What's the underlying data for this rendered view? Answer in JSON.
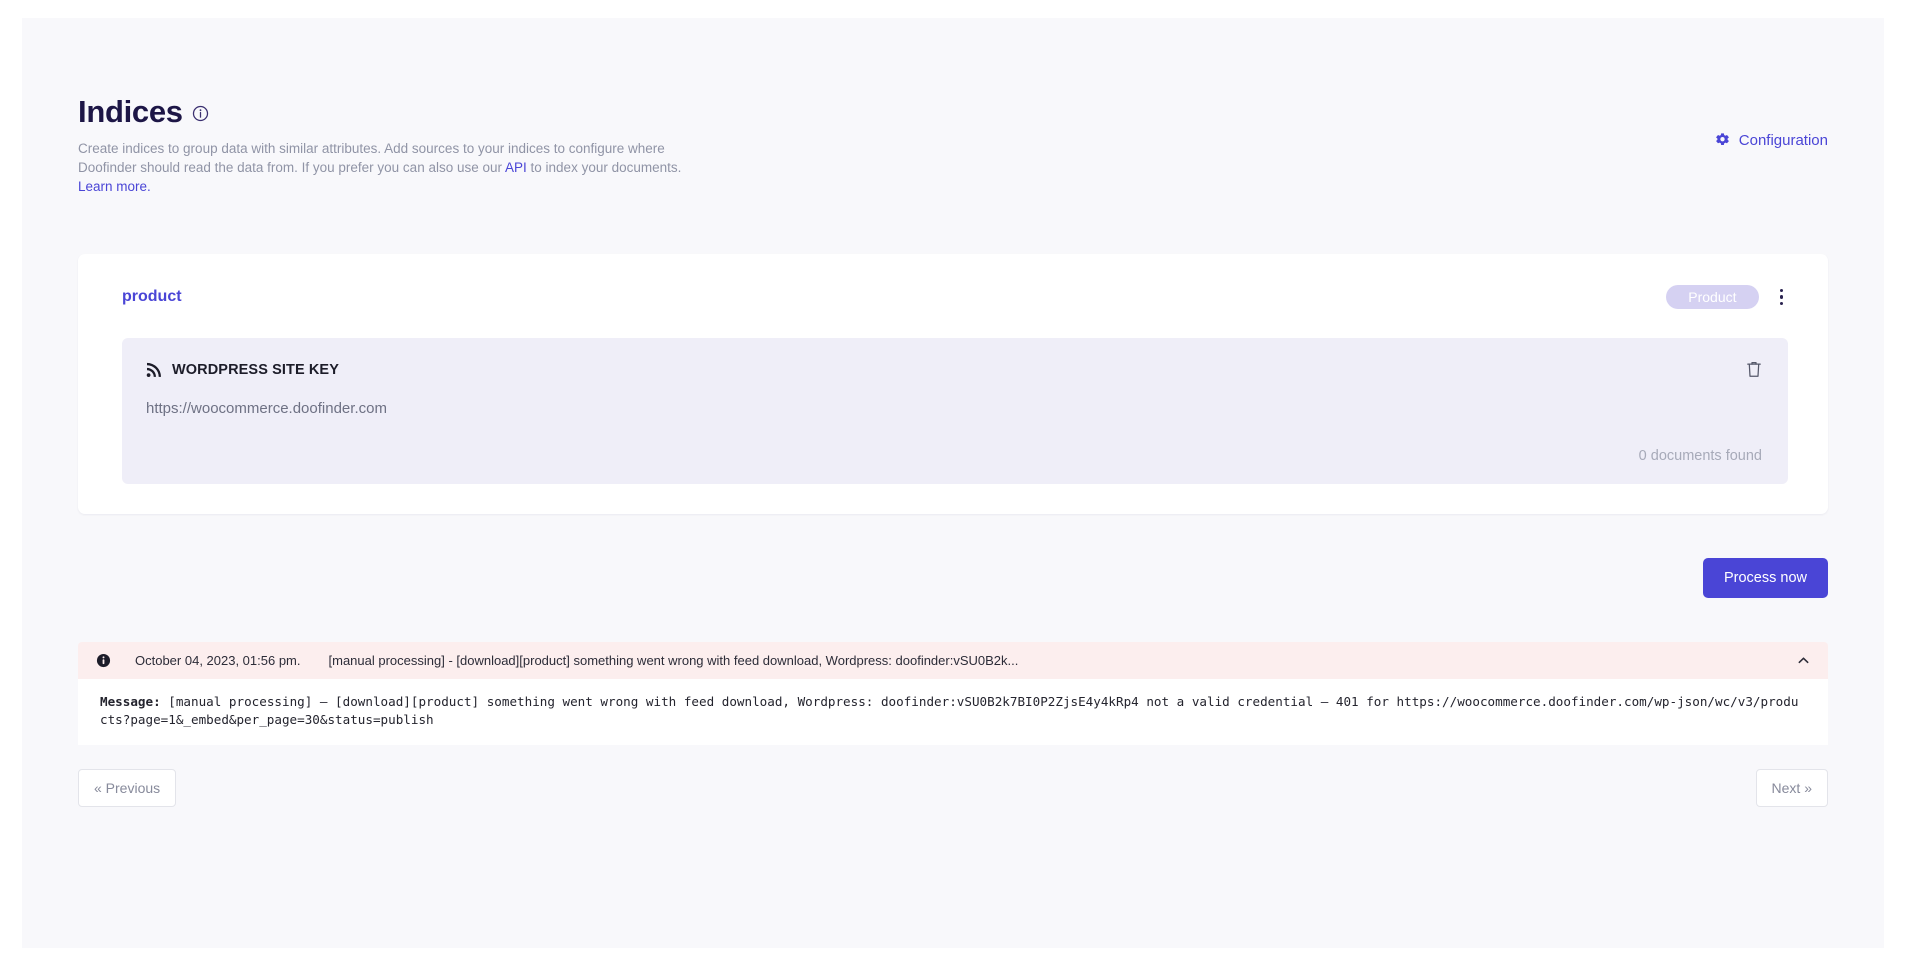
{
  "header": {
    "title": "Indices",
    "info_icon": "info-circle-icon",
    "description_part1": "Create indices to group data with similar attributes. Add sources to your indices to configure where Doofinder should read the data from. If you prefer you can also use our ",
    "description_link": "API",
    "description_part2": " to index your documents.",
    "learn_more": "Learn more.",
    "configuration_label": "Configuration",
    "configuration_icon": "gear-icon"
  },
  "index_card": {
    "name": "product",
    "badge": "Product",
    "kebab_icon": "kebab-menu-icon",
    "source": {
      "icon": "rss-feed-icon",
      "title": "WORDPRESS SITE KEY",
      "url": "https://woocommerce.doofinder.com",
      "delete_icon": "trash-icon",
      "documents_found": "0 documents found"
    }
  },
  "actions": {
    "process_now": "Process now"
  },
  "log": {
    "icon": "info-filled-icon",
    "date": "October 04, 2023, 01:56 pm.",
    "summary": "[manual processing] - [download][product] something went wrong with feed download, Wordpress: doofinder:vSU0B2k...",
    "collapse_icon": "chevron-up-icon",
    "message_label": "Message:",
    "message_body": " [manual processing] – [download][product] something went wrong with feed download, Wordpress: doofinder:vSU0B2k7BI0P2ZjsE4y4kRp4 not a valid credential – 401 for https://woocommerce.doofinder.com/wp-json/wc/v3/products?page=1&_embed&per_page=30&status=publish"
  },
  "pagination": {
    "previous": "« Previous",
    "next": "Next »"
  },
  "colors": {
    "accent": "#4a45d6",
    "title": "#1d1646",
    "badge_bg": "#d5d1f2",
    "source_bg": "#efeef8",
    "error_bg": "#fceeee",
    "page_bg": "#f8f8fb"
  }
}
